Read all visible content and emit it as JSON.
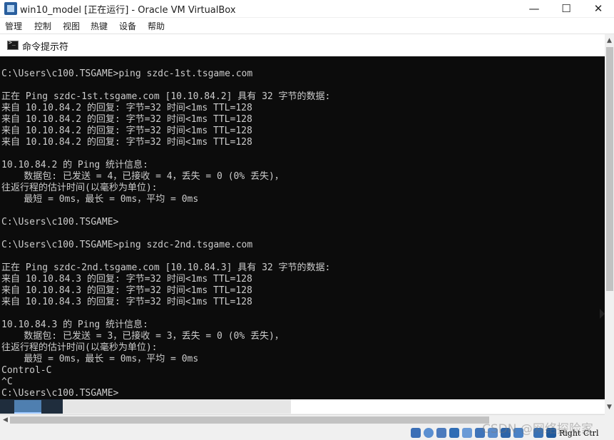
{
  "window": {
    "title": "win10_model [正在运行] - Oracle VM VirtualBox",
    "minimize_glyph": "—",
    "maximize_glyph": "☐",
    "close_glyph": "✕"
  },
  "menu": {
    "items": [
      "管理",
      "控制",
      "视图",
      "热键",
      "设备",
      "帮助"
    ]
  },
  "cmd": {
    "title": "命令提示符",
    "lines": [
      "C:\\Users\\c100.TSGAME>ping szdc-1st.tsgame.com",
      "",
      "正在 Ping szdc-1st.tsgame.com [10.10.84.2] 具有 32 字节的数据:",
      "来自 10.10.84.2 的回复: 字节=32 时间<1ms TTL=128",
      "来自 10.10.84.2 的回复: 字节=32 时间<1ms TTL=128",
      "来自 10.10.84.2 的回复: 字节=32 时间<1ms TTL=128",
      "来自 10.10.84.2 的回复: 字节=32 时间<1ms TTL=128",
      "",
      "10.10.84.2 的 Ping 统计信息:",
      "    数据包: 已发送 = 4，已接收 = 4，丢失 = 0 (0% 丢失)，",
      "往返行程的估计时间(以毫秒为单位):",
      "    最短 = 0ms，最长 = 0ms，平均 = 0ms",
      "",
      "C:\\Users\\c100.TSGAME>",
      "",
      "C:\\Users\\c100.TSGAME>ping szdc-2nd.tsgame.com",
      "",
      "正在 Ping szdc-2nd.tsgame.com [10.10.84.3] 具有 32 字节的数据:",
      "来自 10.10.84.3 的回复: 字节=32 时间<1ms TTL=128",
      "来自 10.10.84.3 的回复: 字节=32 时间<1ms TTL=128",
      "来自 10.10.84.3 的回复: 字节=32 时间<1ms TTL=128",
      "",
      "10.10.84.3 的 Ping 统计信息:",
      "    数据包: 已发送 = 3，已接收 = 3，丢失 = 0 (0% 丢失)，",
      "往返行程的估计时间(以毫秒为单位):",
      "    最短 = 0ms，最长 = 0ms，平均 = 0ms",
      "Control-C",
      "^C",
      "C:\\Users\\c100.TSGAME>"
    ]
  },
  "statusbar": {
    "host_key": "Right Ctrl",
    "icons": [
      "hard-disk-icon",
      "optical-drive-icon",
      "audio-icon",
      "network-icon",
      "usb-icon",
      "shared-folders-icon",
      "display-icon",
      "video-capture-icon",
      "cpu-icon",
      "mouse-integration-icon",
      "host-key-icon"
    ]
  },
  "watermark": "CSDN @网络探险家",
  "colors": {
    "console_bg": "#0c0c0c",
    "console_text": "#cccccc",
    "chrome_bg": "#f0f0f0"
  }
}
